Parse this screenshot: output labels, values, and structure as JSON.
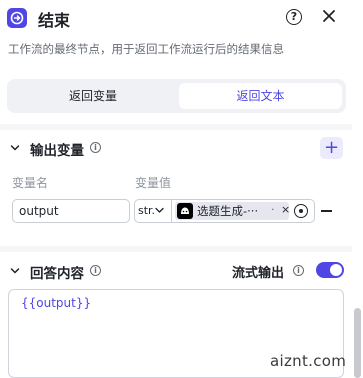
{
  "header": {
    "title": "结束",
    "description": "工作流的最终节点，用于返回工作流运行后的结果信息",
    "help_symbol": "?"
  },
  "tabs": [
    {
      "label": "返回变量",
      "active": false
    },
    {
      "label": "返回文本",
      "active": true
    }
  ],
  "output_section": {
    "title": "输出变量",
    "add_symbol": "+",
    "columns": {
      "name": "变量名",
      "value": "变量值"
    },
    "rows": [
      {
        "name": "output",
        "type": "str.",
        "ref_text": "选题生成-···",
        "ref_dot": "·",
        "ref_close": "×"
      }
    ]
  },
  "answer_section": {
    "title": "回答内容",
    "stream_label": "流式输出",
    "stream_enabled": true,
    "content": "{{output}}"
  },
  "watermark": "aiznt.com",
  "colors": {
    "accent": "#4f46e5",
    "accent_light": "#eceafd",
    "text": "#1f2329",
    "muted": "#646a73"
  },
  "icons": [
    "end-node-icon",
    "help-icon",
    "close-icon",
    "chevron-down-icon",
    "info-icon",
    "plus-icon",
    "robot-avatar-icon",
    "target-icon",
    "minus-icon"
  ]
}
